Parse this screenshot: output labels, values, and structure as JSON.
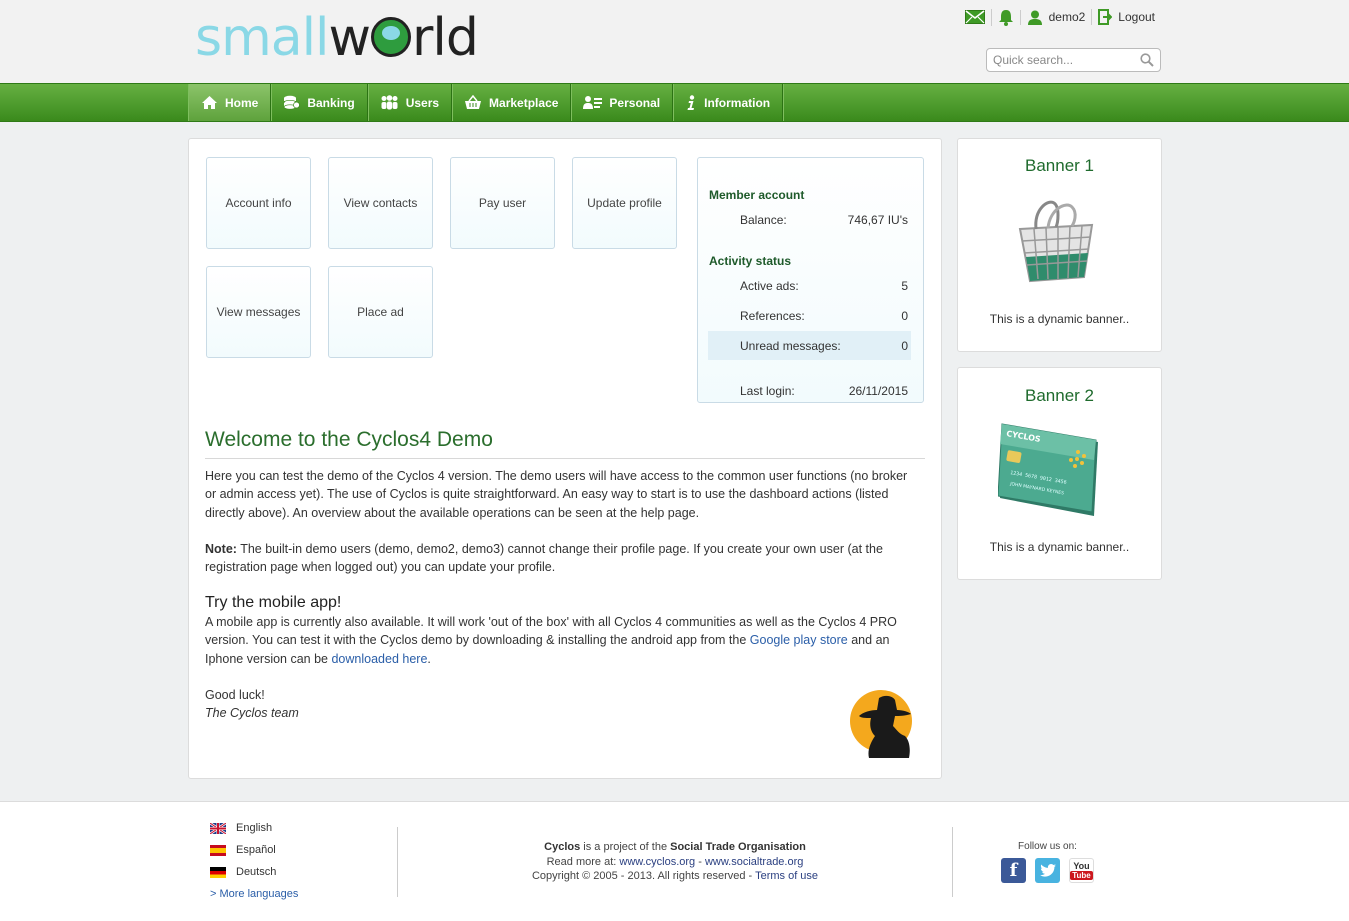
{
  "header": {
    "logo_small": "small",
    "logo_world_1": "w",
    "logo_world_2": "rld",
    "user_name": "demo2",
    "logout_label": "Logout",
    "search_placeholder": "Quick search..."
  },
  "nav": {
    "items": [
      {
        "label": "Home",
        "icon": "home-icon"
      },
      {
        "label": "Banking",
        "icon": "coins-icon"
      },
      {
        "label": "Users",
        "icon": "users-icon"
      },
      {
        "label": "Marketplace",
        "icon": "basket-icon"
      },
      {
        "label": "Personal",
        "icon": "profile-icon"
      },
      {
        "label": "Information",
        "icon": "info-icon"
      }
    ]
  },
  "dashboard": {
    "tiles": [
      "Account info",
      "View contacts",
      "Pay user",
      "Update profile",
      "View messages",
      "Place ad"
    ]
  },
  "account": {
    "member_title": "Member account",
    "balance_label": "Balance:",
    "balance_value": "746,67 IU's",
    "activity_title": "Activity status",
    "active_ads_label": "Active ads:",
    "active_ads_value": "5",
    "references_label": "References:",
    "references_value": "0",
    "unread_label": "Unread messages:",
    "unread_value": "0",
    "last_login_label": "Last login:",
    "last_login_value": "26/11/2015"
  },
  "welcome": {
    "title": "Welcome to the Cyclos4 Demo",
    "para1": "Here you can test the demo of the Cyclos 4 version. The demo users will have access to the common user functions (no broker or admin access yet). The use of Cyclos is quite straightforward. An easy way to start is to use the dashboard actions (listed directly above). An overview about the available operations can be seen at the help page.",
    "note_label": "Note:",
    "note_text": " The built-in demo users (demo, demo2, demo3) cannot change their profile page. If you create your own user (at the registration page when logged out) you can update your profile.",
    "mobile_title": "Try the mobile app!",
    "mobile_text_1": "A mobile app is currently also available. It will work 'out of the box' with all Cyclos 4 communities as well as the Cyclos 4 PRO version. You can test it with the Cyclos demo by downloading & installing the android app from the ",
    "mobile_link_1": "Google play store",
    "mobile_text_2": "and an Iphone version can be ",
    "mobile_link_2": "downloaded here",
    "mobile_text_3": ".",
    "good_luck": "Good luck!",
    "signature": "The Cyclos team"
  },
  "banners": [
    {
      "title": "Banner 1",
      "text": "This is a dynamic banner.."
    },
    {
      "title": "Banner 2",
      "text": "This is a dynamic banner.."
    }
  ],
  "card": {
    "brand": "CYCLOS",
    "number": "1234 5678 9012 3456",
    "holder": "JOHN MAYNARD KEYNES"
  },
  "footer": {
    "languages": [
      "English",
      "Español",
      "Deutsch"
    ],
    "more_languages": "> More languages",
    "line1_bold": "Cyclos",
    "line1_mid": " is a project of the ",
    "line1_org": "Social Trade Organisation",
    "line2_label": "Read more at: ",
    "line2_link1": "www.cyclos.org",
    "line2_sep": " - ",
    "line2_link2": "www.socialtrade.org",
    "line3_text": "Copyright © 2005 - 2013. All rights reserved - ",
    "line3_link": "Terms of use",
    "follow_label": "Follow us on:",
    "social": [
      "facebook",
      "twitter",
      "youtube"
    ],
    "youtube_you": "You",
    "youtube_tube": "Tube"
  }
}
